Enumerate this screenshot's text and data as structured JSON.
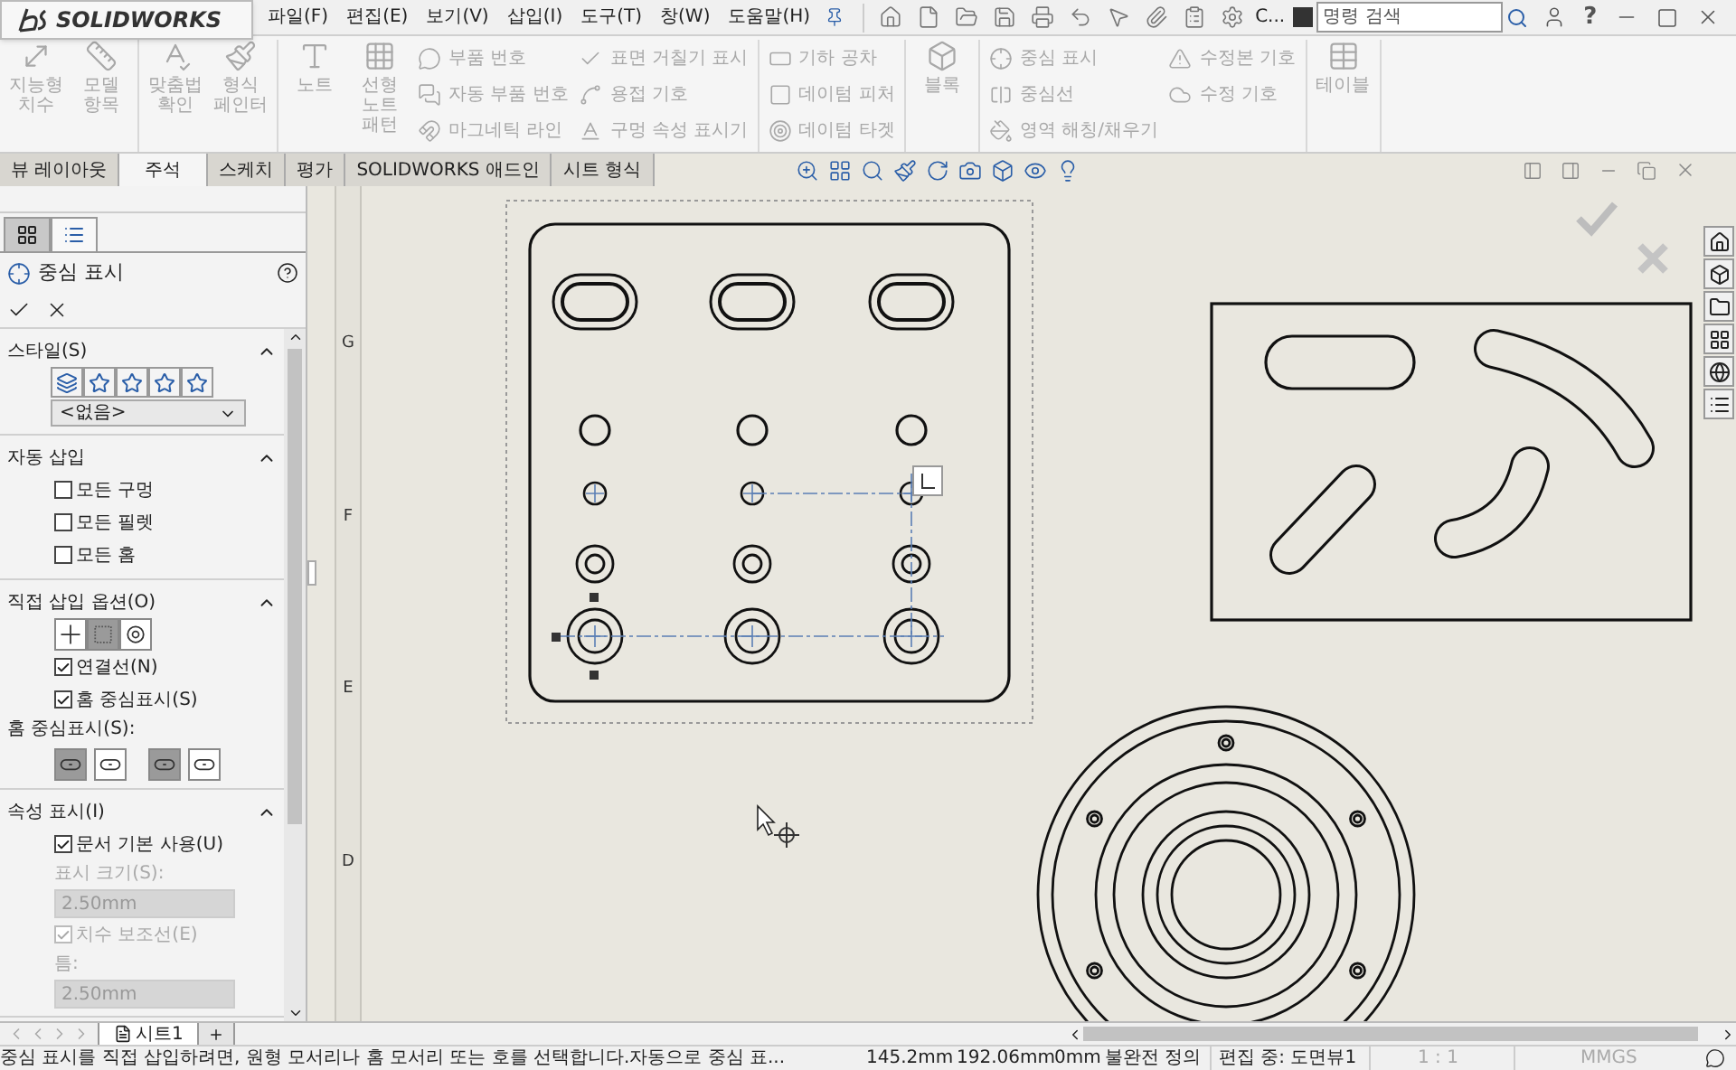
{
  "app": {
    "logo": "SOLIDWORKS",
    "menu": [
      "파일(F)",
      "편집(E)",
      "보기(V)",
      "삽입(I)",
      "도구(T)",
      "창(W)",
      "도움말(H)"
    ],
    "overflow": "C...",
    "search": {
      "placeholder": "명령 검색"
    },
    "help": "?"
  },
  "ribbon": {
    "groups": [
      {
        "buttons": [
          {
            "kind": "large",
            "label": "지능형 치수",
            "disabled": true
          },
          {
            "kind": "large",
            "label": "모델 항목",
            "disabled": true
          }
        ]
      },
      {
        "buttons": [
          {
            "kind": "large",
            "label": "맞춤법 확인",
            "disabled": true
          },
          {
            "kind": "large",
            "label": "형식 페인터",
            "disabled": true
          }
        ]
      },
      {
        "buttons": [
          {
            "kind": "large",
            "label": "노트",
            "disabled": true
          },
          {
            "kind": "large",
            "label": "선형 노트 패턴",
            "disabled": true
          },
          {
            "kind": "small",
            "label": "부품 번호",
            "disabled": true
          },
          {
            "kind": "small",
            "label": "자동 부품 번호",
            "disabled": true
          },
          {
            "kind": "small",
            "label": "마그네틱 라인",
            "disabled": true
          },
          {
            "kind": "small",
            "label": "표면 거칠기 표시",
            "disabled": true
          },
          {
            "kind": "small",
            "label": "용접 기호",
            "disabled": true
          },
          {
            "kind": "small",
            "label": "구멍 속성 표시기",
            "disabled": true
          }
        ]
      },
      {
        "buttons": [
          {
            "kind": "small",
            "label": "기하 공차",
            "disabled": true
          },
          {
            "kind": "small",
            "label": "데이텀 피처",
            "disabled": true
          },
          {
            "kind": "small",
            "label": "데이텀 타겟",
            "disabled": true
          }
        ]
      },
      {
        "buttons": [
          {
            "kind": "large",
            "label": "블록",
            "disabled": true
          }
        ]
      },
      {
        "buttons": [
          {
            "kind": "small",
            "label": "중심 표시",
            "disabled": true
          },
          {
            "kind": "small",
            "label": "중심선",
            "disabled": true
          },
          {
            "kind": "small",
            "label": "영역 해칭/채우기",
            "disabled": true
          },
          {
            "kind": "small",
            "label": "수정본 기호",
            "disabled": true
          },
          {
            "kind": "small",
            "label": "수정 기호",
            "disabled": true
          }
        ]
      },
      {
        "buttons": [
          {
            "kind": "large",
            "label": "테이블",
            "disabled": true
          }
        ]
      }
    ]
  },
  "tabs": [
    {
      "label": "뷰 레이아웃",
      "selected": false
    },
    {
      "label": "주석",
      "selected": true
    },
    {
      "label": "스케치",
      "selected": false
    },
    {
      "label": "평가",
      "selected": false
    },
    {
      "label": "SOLIDWORKS 애드인",
      "selected": false
    },
    {
      "label": "시트 형식",
      "selected": false
    }
  ],
  "panel": {
    "tabs": [
      {
        "selected": false
      },
      {
        "selected": true
      }
    ],
    "title": "중심 표시",
    "sections": [
      {
        "kind": "style",
        "title": "스타일(S)",
        "expanded": true,
        "dropdown": "<없음>"
      },
      {
        "kind": "auto",
        "title": "자동 삽입",
        "expanded": true,
        "checkboxes": [
          {
            "label": "모든 구멍",
            "checked": false
          },
          {
            "label": "모든 필렛",
            "checked": false
          },
          {
            "label": "모든 홈",
            "checked": false
          }
        ]
      },
      {
        "kind": "manual",
        "title": "직접 삽입 옵션(O)",
        "expanded": true,
        "modes": [
          {
            "selected": false
          },
          {
            "selected": true
          },
          {
            "selected": false
          }
        ],
        "checkboxes": [
          {
            "label": "연결선(N)",
            "checked": true
          },
          {
            "label": "홈 중심표시(S)",
            "checked": true
          }
        ],
        "slot_label": "홈 중심표시(S):",
        "slot_modes": [
          {
            "selected": true
          },
          {
            "selected": false
          },
          {
            "selected": true
          },
          {
            "selected": false
          }
        ]
      },
      {
        "kind": "props",
        "title": "속성 표시(I)",
        "expanded": true,
        "rows": [
          {
            "kind": "checkbox",
            "label": "문서 기본 사용(U)",
            "checked": true,
            "disabled": false
          },
          {
            "kind": "label",
            "label": "표시 크기(S):",
            "disabled": true
          },
          {
            "kind": "field",
            "value": "2.50mm",
            "disabled": true
          },
          {
            "kind": "checkbox",
            "label": "치수 보조선(E)",
            "checked": true,
            "disabled": true
          },
          {
            "kind": "label",
            "label": "틈:",
            "disabled": true
          },
          {
            "kind": "field",
            "value": "2.50mm",
            "disabled": true
          }
        ]
      }
    ]
  },
  "ruler": [
    "G",
    "F",
    "E",
    "D"
  ],
  "sheet_tabs": [
    {
      "label": "시트1",
      "selected": true
    }
  ],
  "status_bar": {
    "message": "중심 표시를 직접 삽입하려면, 원형 모서리나 홈 모서리 또는 호를 선택합니다.자동으로 중심 표...",
    "x": "145.2mm",
    "y": "192.06mm",
    "z": "0mm",
    "definition": "불완전 정의",
    "editing": "편집 중: 도면뷰1",
    "scale": "1 : 1",
    "units": "MMGS"
  }
}
